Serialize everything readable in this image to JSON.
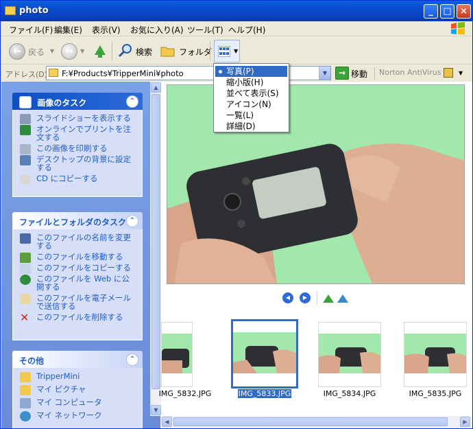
{
  "window": {
    "title": "photo"
  },
  "menu": [
    "ファイル(F)",
    "編集(E)",
    "表示(V)",
    "お気に入り(A)",
    "ツール(T)",
    "ヘルプ(H)"
  ],
  "toolbar": {
    "back": "戻る",
    "search": "検索",
    "folder": "フォルダ"
  },
  "address": {
    "label": "アドレス(D)",
    "value": "F:¥Products¥TripperMini¥photo",
    "go": "移動",
    "antivirus": "Norton AntiVirus"
  },
  "view_menu": {
    "items": [
      {
        "label": "写真(P)",
        "selected": true
      },
      {
        "label": "縮小版(H)"
      },
      {
        "label": "並べて表示(S)"
      },
      {
        "label": "アイコン(N)"
      },
      {
        "label": "一覧(L)"
      },
      {
        "label": "詳細(D)"
      }
    ]
  },
  "sidebar": {
    "image_tasks": {
      "title": "画像のタスク",
      "items": [
        "スライドショーを表示する",
        "オンラインでプリントを注文する",
        "この画像を印刷する",
        "デスクトップの背景に設定する",
        "CD にコピーする"
      ]
    },
    "file_tasks": {
      "title": "ファイルとフォルダのタスク",
      "items": [
        "このファイルの名前を変更する",
        "このファイルを移動する",
        "このファイルをコピーする",
        "このファイルを Web に公開する",
        "このファイルを電子メールで送信する",
        "このファイルを削除する"
      ]
    },
    "other": {
      "title": "その他",
      "items": [
        "TripperMini",
        "マイ ピクチャ",
        "マイ コンピュータ",
        "マイ ネットワーク"
      ]
    }
  },
  "thumbnails": [
    {
      "name": "IMG_5832.JPG"
    },
    {
      "name": "IMG_5833.JPG",
      "selected": true
    },
    {
      "name": "IMG_5834.JPG"
    },
    {
      "name": "IMG_5835.JPG"
    }
  ]
}
